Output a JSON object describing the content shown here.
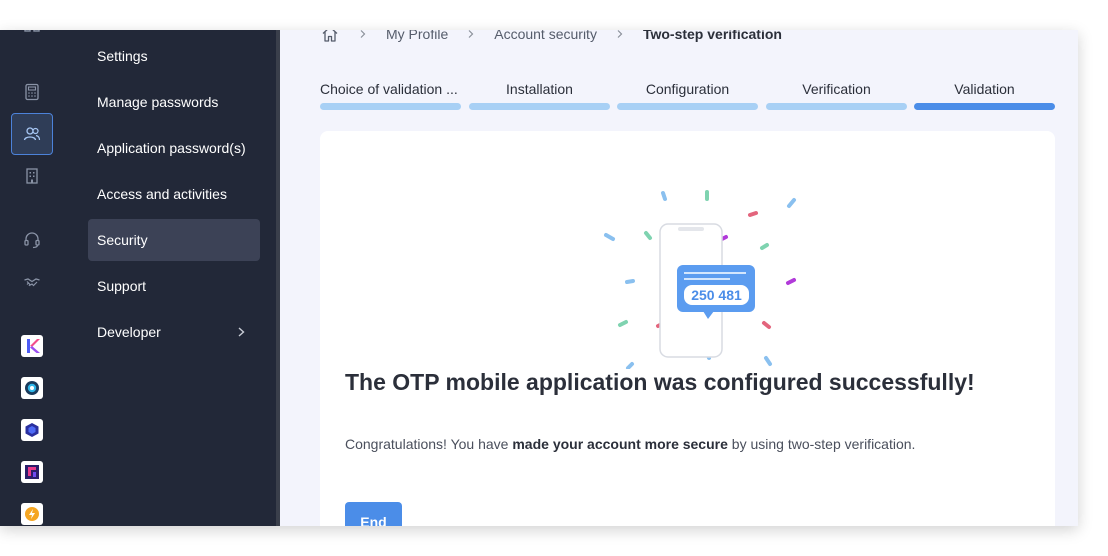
{
  "colors": {
    "sidebar_bg": "#222838",
    "accent": "#4b8de8",
    "step_done": "#a8d0f5",
    "content_bg": "#f3f4fc"
  },
  "rail": {
    "icons": [
      "grid-icon",
      "calculator-icon",
      "users-icon",
      "building-icon",
      "headset-icon",
      "handshake-icon"
    ],
    "active_icon": "users-icon",
    "app_logos": [
      "kchat-logo",
      "kdrive-logo",
      "kstorage-logo",
      "kmeet-logo",
      "kalert-logo"
    ]
  },
  "menu": {
    "items": [
      {
        "label": "Settings"
      },
      {
        "label": "Manage passwords"
      },
      {
        "label": "Application password(s)"
      },
      {
        "label": "Access and activities"
      },
      {
        "label": "Security",
        "active": true
      },
      {
        "label": "Support"
      },
      {
        "label": "Developer",
        "has_submenu": true
      }
    ]
  },
  "breadcrumb": {
    "items": [
      "My Profile",
      "Account security"
    ],
    "current": "Two-step verification"
  },
  "steps": {
    "items": [
      "Choice of validation ...",
      "Installation",
      "Configuration",
      "Verification",
      "Validation"
    ],
    "current": "Validation"
  },
  "illustration": {
    "otp_code": "250 481"
  },
  "content": {
    "title": "The OTP mobile application was configured successfully!",
    "desc_before": "Congratulations! You have ",
    "desc_bold": "made your account more secure",
    "desc_after": " by using two-step verification.",
    "button_label": "End"
  }
}
